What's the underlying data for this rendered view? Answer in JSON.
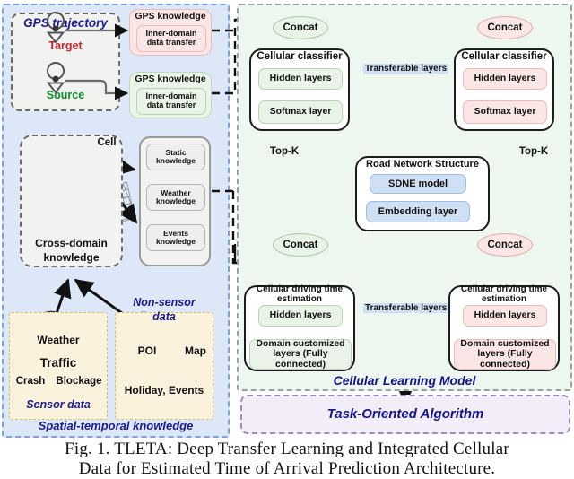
{
  "figure": {
    "caption_line1": "Fig. 1.  TLETA: Deep Transfer Learning and Integrated Cellular",
    "caption_line2": "Data for Estimated Time of Arrival Prediction Architecture."
  },
  "colors": {
    "source_green": "#e9f3e7",
    "target_pink": "#fbe6e6",
    "road_blue": "#cfe0f4",
    "navy_text": "#1b1b8f",
    "target_label_red": "#c1272d",
    "source_label_green": "#0a8f2a",
    "left_panel_bg": "#dce7f8",
    "right_panel_bg": "#eef7ef",
    "task_panel_bg": "#f2edf8"
  },
  "left_panel": {
    "name": "Spatial-temporal knowledge panel",
    "gps_trajectory": {
      "title": "GPS trajectory",
      "target_label": "Target",
      "source_label": "Source",
      "pin_icon": "map-pin-icon"
    },
    "gps_knowledge_target": {
      "title": "GPS knowledge",
      "inner": "Inner-domain\ndata transfer",
      "inner_line1": "Inner-domain",
      "inner_line2": "data transfer"
    },
    "gps_knowledge_source": {
      "title": "GPS knowledge",
      "inner_line1": "Inner-domain",
      "inner_line2": "data transfer"
    },
    "cross_domain": {
      "cell_label": "Cell",
      "title_line1": "Cross-domain",
      "title_line2": "knowledge",
      "grid_icon": "cell-grid-icon"
    },
    "knowledge_stack": {
      "items": [
        {
          "line1": "Static",
          "line2": "knowledge"
        },
        {
          "line1": "Weather",
          "line2": "knowledge"
        },
        {
          "line1": "Events",
          "line2": "knowledge"
        }
      ]
    },
    "sensor_data": {
      "weather_label": "Weather",
      "traffic_label": "Traffic",
      "crash_label": "Crash",
      "blockage_label": "Blockage",
      "caption": "Sensor data",
      "cloud_icon": "weather-cloud-icon",
      "car_icon": "crash-car-icon"
    },
    "non_sensor_data": {
      "title_line1": "Non-sensor",
      "title_line2": "data",
      "poi_label": "POI",
      "map_label": "Map",
      "holiday_label": "Holiday, Events",
      "poi_icon": "poi-icon",
      "map_icon": "folded-map-icon",
      "calendar_icon": "calendar-icon"
    },
    "footer": "Spatial-temporal knowledge"
  },
  "right_panel": {
    "name": "Cellular Learning Model panel",
    "footer": "Cellular Learning Model",
    "source_column": {
      "concat_top": "Concat",
      "classifier_title": "Cellular classifier",
      "hidden_layers": "Hidden layers",
      "softmax_layer": "Softmax layer",
      "topk": "Top-K",
      "concat_bottom": "Concat",
      "estimator_title": "Cellular driving time estimation",
      "est_hidden_layers": "Hidden layers",
      "domain_layers_line1": "Domain customized",
      "domain_layers_line2": "layers (Fully connected)"
    },
    "target_column": {
      "concat_top": "Concat",
      "classifier_title": "Cellular classifier",
      "hidden_layers": "Hidden layers",
      "softmax_layer": "Softmax layer",
      "topk": "Top-K",
      "concat_bottom": "Concat",
      "estimator_title": "Cellular driving time estimation",
      "est_hidden_layers": "Hidden layers",
      "domain_layers_line1": "Domain customized",
      "domain_layers_line2": "layers (Fully connected)"
    },
    "transferable_top": "Transferable layers",
    "transferable_bottom": "Transferable layers",
    "road_network": {
      "title": "Road Network Structure",
      "sdne_model": "SDNE model",
      "embedding_layer": "Embedding layer"
    }
  },
  "task_panel": {
    "label": "Task-Oriented Algorithm"
  }
}
